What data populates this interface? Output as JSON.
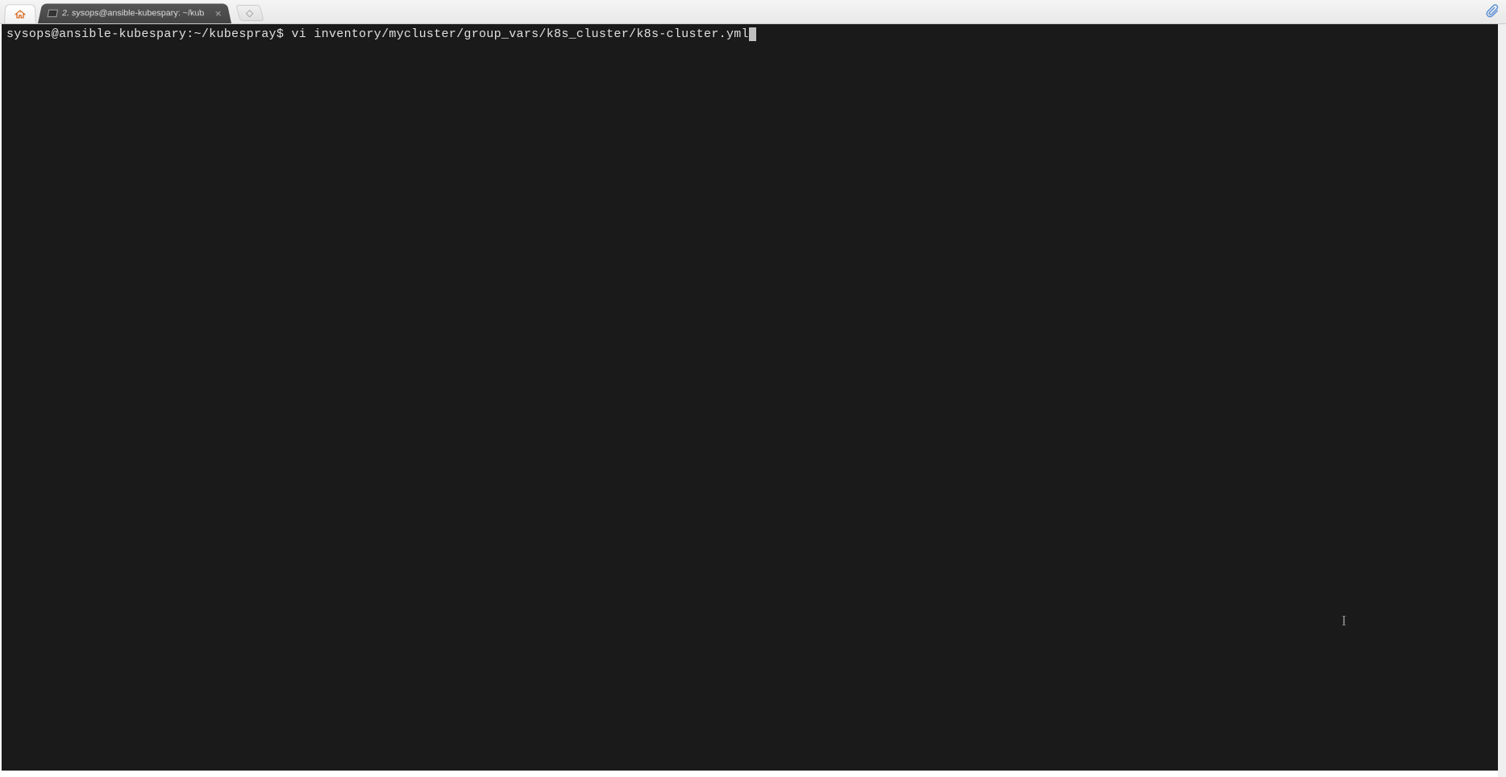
{
  "tab": {
    "title": "2. sysops@ansible-kubespary: ~/kub"
  },
  "terminal": {
    "prompt": "sysops@ansible-kubespary:~/kubespray$ ",
    "command": "vi inventory/mycluster/group_vars/k8s_cluster/k8s-cluster.yml"
  }
}
